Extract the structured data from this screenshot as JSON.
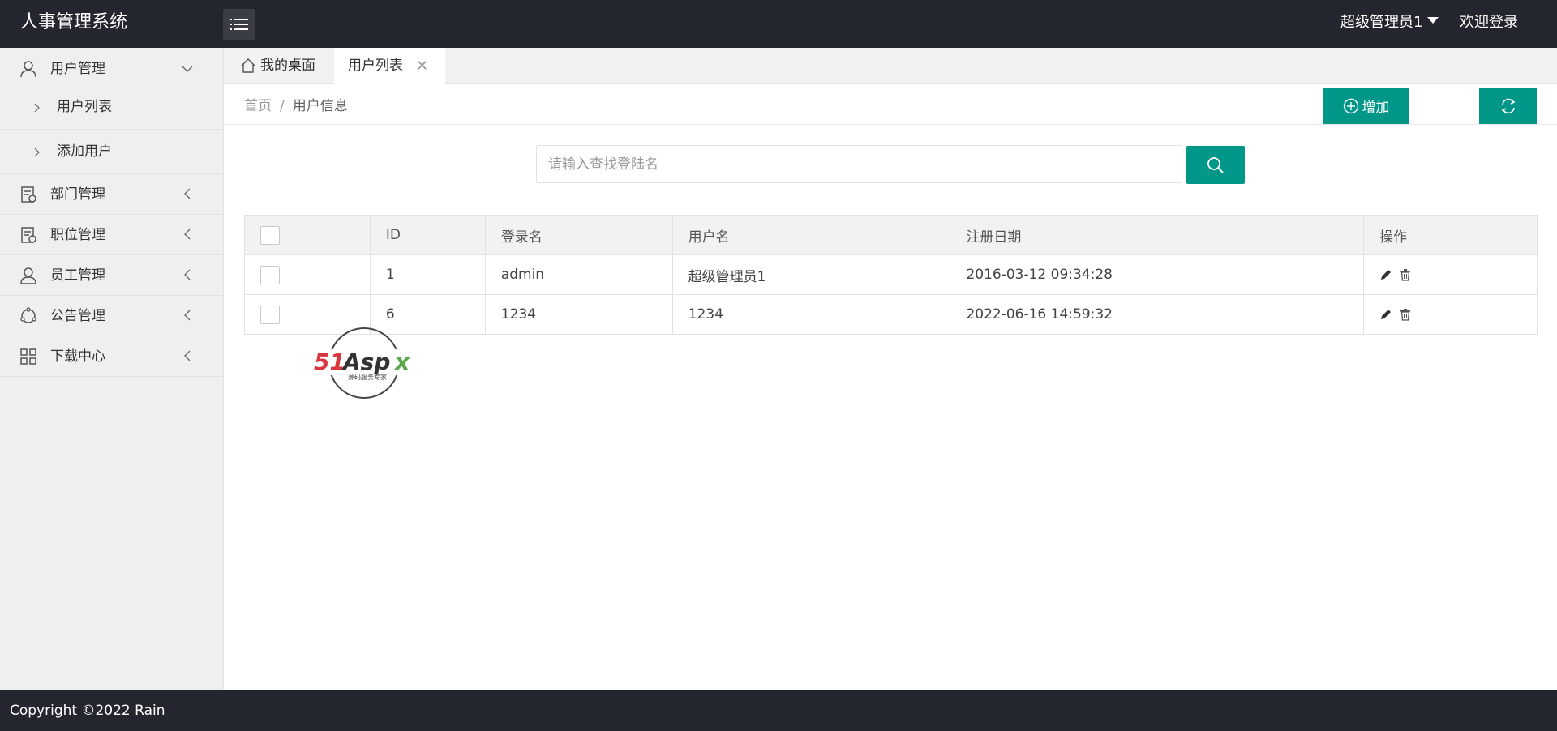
{
  "header": {
    "logo": "人事管理系统",
    "user_name": "超级管理员1",
    "welcome": "欢迎登录"
  },
  "sidebar": {
    "groups": [
      {
        "label": "用户管理",
        "icon": "user-icon",
        "expanded": true,
        "children": [
          {
            "label": "用户列表"
          },
          {
            "label": "添加用户"
          }
        ]
      },
      {
        "label": "部门管理",
        "icon": "department-icon"
      },
      {
        "label": "职位管理",
        "icon": "position-icon"
      },
      {
        "label": "员工管理",
        "icon": "employee-icon"
      },
      {
        "label": "公告管理",
        "icon": "notice-icon"
      },
      {
        "label": "下载中心",
        "icon": "grid-icon"
      }
    ]
  },
  "tabs": [
    {
      "label": "我的桌面",
      "icon": "home-icon"
    },
    {
      "label": "用户列表",
      "active": true,
      "close": "✕"
    }
  ],
  "breadcrumb": {
    "home": "首页",
    "separator": "/",
    "current": "用户信息"
  },
  "toolbar": {
    "add_label": "增加"
  },
  "search": {
    "placeholder": "请输入查找登陆名"
  },
  "table": {
    "columns": [
      "",
      "ID",
      "登录名",
      "用户名",
      "注册日期",
      "操作"
    ],
    "rows": [
      {
        "id": "1",
        "login": "admin",
        "username": "超级管理员1",
        "date": "2016-03-12 09:34:28"
      },
      {
        "id": "6",
        "login": "1234",
        "username": "1234",
        "date": "2022-06-16 14:59:32"
      }
    ]
  },
  "watermark": {
    "brand": "51Aspx",
    "tagline": "源码服务专家"
  },
  "footer": {
    "copyright": "Copyright ©2022 Rain"
  },
  "colors": {
    "header_bg": "#23262e",
    "accent": "#009688",
    "sidebar_bg": "#efefef",
    "tabbar_bg": "#f2f2f2"
  }
}
